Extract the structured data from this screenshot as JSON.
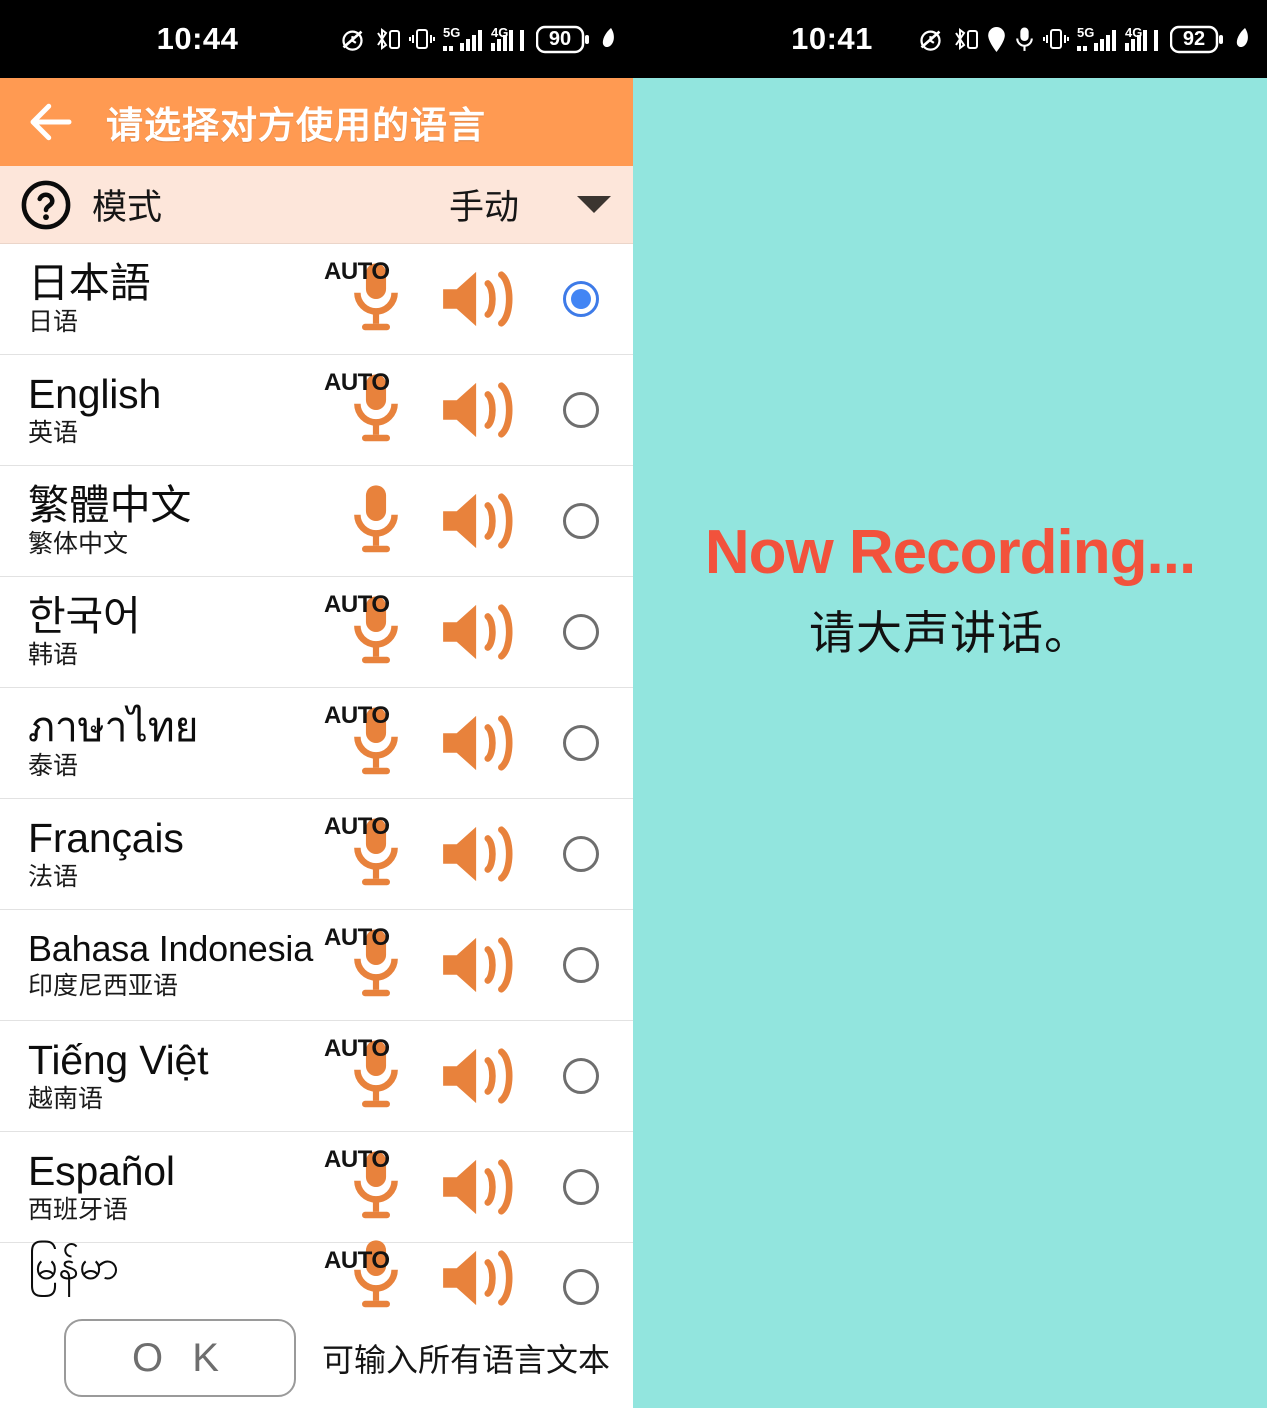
{
  "left_screen": {
    "status_bar": {
      "time": "10:44",
      "battery": "90",
      "net_5g": "5G",
      "net_4g": "4G",
      "icons": [
        "alarm-off-icon",
        "bluetooth-device-icon",
        "vibrate-icon",
        "signal-5g-icon",
        "signal-4g-icon",
        "battery-icon",
        "leaf-icon"
      ]
    },
    "appbar": {
      "back": "back-arrow-icon",
      "title": "请选择对方使用的语言"
    },
    "mode_bar": {
      "help": "help-circle-icon",
      "label": "模式",
      "value": "手动",
      "caret": "chevron-down-icon"
    },
    "languages": [
      {
        "native": "日本語",
        "sub": "日语",
        "auto": "AUTO",
        "selected": true
      },
      {
        "native": "English",
        "sub": "英语",
        "auto": "AUTO",
        "selected": false
      },
      {
        "native": "繁體中文",
        "sub": "繁体中文",
        "auto": "",
        "selected": false
      },
      {
        "native": "한국어",
        "sub": "韩语",
        "auto": "AUTO",
        "selected": false
      },
      {
        "native": "ภาษาไทย",
        "sub": "泰语",
        "auto": "AUTO",
        "selected": false
      },
      {
        "native": "Français",
        "sub": "法语",
        "auto": "AUTO",
        "selected": false
      },
      {
        "native": "Bahasa Indonesia",
        "sub": "印度尼西亚语",
        "auto": "AUTO",
        "selected": false
      },
      {
        "native": "Tiếng Việt",
        "sub": "越南语",
        "auto": "AUTO",
        "selected": false
      },
      {
        "native": "Español",
        "sub": "西班牙语",
        "auto": "AUTO",
        "selected": false
      },
      {
        "native": "မြန်မာ",
        "sub": "",
        "auto": "AUTO",
        "selected": false
      }
    ],
    "bottom_bar": {
      "ok_label": "O K",
      "hint": "可输入所有语言文本"
    }
  },
  "right_screen": {
    "status_bar": {
      "time": "10:41",
      "battery": "92",
      "net_5g": "5G",
      "net_4g": "4G",
      "icons": [
        "alarm-off-icon",
        "bluetooth-device-icon",
        "location-icon",
        "microphone-icon",
        "vibrate-icon",
        "signal-5g-icon",
        "signal-4g-icon",
        "battery-icon",
        "leaf-icon"
      ]
    },
    "recording": {
      "title": "Now Recording...",
      "subtitle": "请大声讲话。"
    },
    "stop_button": {
      "icon": "stop-square-icon"
    }
  },
  "colors": {
    "appbar_orange": "#FF9A52",
    "mode_peach": "#FDE6DA",
    "teal_bg": "#92E5DE",
    "icon_orange": "#E8823C",
    "radio_blue": "#4285F4",
    "rec_red": "#F2523C",
    "stop_gray": "#7C7C7C"
  }
}
